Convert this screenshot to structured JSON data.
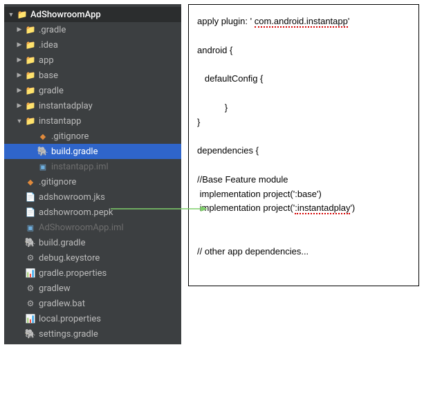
{
  "tree": {
    "root": "AdShowroomApp",
    "root_suffix": "",
    "items": [
      {
        "label": ".gradle",
        "arrow": "right",
        "indent": 1,
        "icon": "folder-orange",
        "dim": false
      },
      {
        "label": ".idea",
        "arrow": "right",
        "indent": 1,
        "icon": "folder",
        "dim": false
      },
      {
        "label": "app",
        "arrow": "right",
        "indent": 1,
        "icon": "folder",
        "dim": false
      },
      {
        "label": "base",
        "arrow": "right",
        "indent": 1,
        "icon": "folder",
        "dim": false
      },
      {
        "label": "gradle",
        "arrow": "right",
        "indent": 1,
        "icon": "folder",
        "dim": false
      },
      {
        "label": "instantadplay",
        "arrow": "right",
        "indent": 1,
        "icon": "folder",
        "dim": false
      },
      {
        "label": "instantapp",
        "arrow": "down",
        "indent": 1,
        "icon": "folder",
        "dim": false
      },
      {
        "label": ".gitignore",
        "arrow": "none",
        "indent": 2,
        "icon": "diamond",
        "dim": false
      },
      {
        "label": "build.gradle",
        "arrow": "none",
        "indent": 2,
        "icon": "gradle",
        "dim": false,
        "selected": true
      },
      {
        "label": "instantapp.iml",
        "arrow": "none",
        "indent": 2,
        "icon": "module",
        "dim": true
      },
      {
        "label": ".gitignore",
        "arrow": "none",
        "indent": 1,
        "icon": "diamond",
        "dim": false
      },
      {
        "label": "adshowroom.jks",
        "arrow": "none",
        "indent": 1,
        "icon": "file",
        "dim": false
      },
      {
        "label": "adshowroom.pepk",
        "arrow": "none",
        "indent": 1,
        "icon": "file",
        "dim": false
      },
      {
        "label": "AdShowroomApp.iml",
        "arrow": "none",
        "indent": 1,
        "icon": "module",
        "dim": true
      },
      {
        "label": "build.gradle",
        "arrow": "none",
        "indent": 1,
        "icon": "gradle",
        "dim": false
      },
      {
        "label": "debug.keystore",
        "arrow": "none",
        "indent": 1,
        "icon": "gear",
        "dim": false
      },
      {
        "label": "gradle.properties",
        "arrow": "none",
        "indent": 1,
        "icon": "prop",
        "dim": false
      },
      {
        "label": "gradlew",
        "arrow": "none",
        "indent": 1,
        "icon": "gear",
        "dim": false
      },
      {
        "label": "gradlew.bat",
        "arrow": "none",
        "indent": 1,
        "icon": "gear",
        "dim": false
      },
      {
        "label": "local.properties",
        "arrow": "none",
        "indent": 1,
        "icon": "prop",
        "dim": false
      },
      {
        "label": "settings.gradle",
        "arrow": "none",
        "indent": 1,
        "icon": "gradle",
        "dim": false
      }
    ]
  },
  "code": {
    "l1a": "apply plugin: ' ",
    "l1b": "com.android.instantapp",
    "l1c": "'",
    "l2": "android {",
    "l3": "   defaultConfig {",
    "l4": "           }",
    "l5": "}",
    "l6": "dependencies {",
    "l7": "//Base Feature module",
    "l8": " implementation project(':base')",
    "l9a": " implementation project('",
    "l9b": ":instantadplay",
    "l9c": "')",
    "l10": "// other app dependencies..."
  }
}
